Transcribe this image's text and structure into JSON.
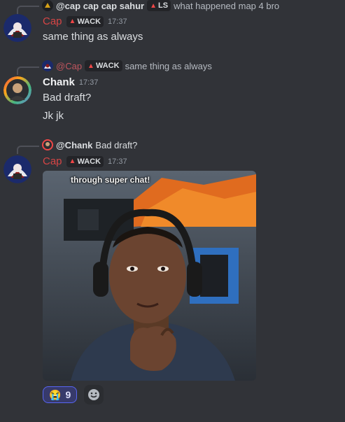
{
  "messages": [
    {
      "reply": {
        "author": "@cap cap cap sahur",
        "tag": "LS",
        "text": "what happened map 4 bro"
      },
      "author": "Cap",
      "tag": "WACK",
      "time": "17:37",
      "lines": [
        "same thing as always"
      ]
    },
    {
      "reply": {
        "author": "@Cap",
        "tag": "WACK",
        "text": "same thing as always"
      },
      "author": "Chank",
      "time": "17:37",
      "lines": [
        "Bad draft?",
        "Jk jk"
      ]
    },
    {
      "reply": {
        "author": "@Chank",
        "text": "Bad draft?"
      },
      "author": "Cap",
      "tag": "WACK",
      "time": "17:37",
      "image": {
        "caption": "through super chat!"
      },
      "reactions": [
        {
          "emoji": "😭",
          "count": "9"
        }
      ]
    }
  ],
  "colors": {
    "background": "#313338",
    "cap_name": "#d64545",
    "reaction_border": "#5865f2"
  },
  "icons": {
    "add_reaction": "smile-plus-icon"
  }
}
